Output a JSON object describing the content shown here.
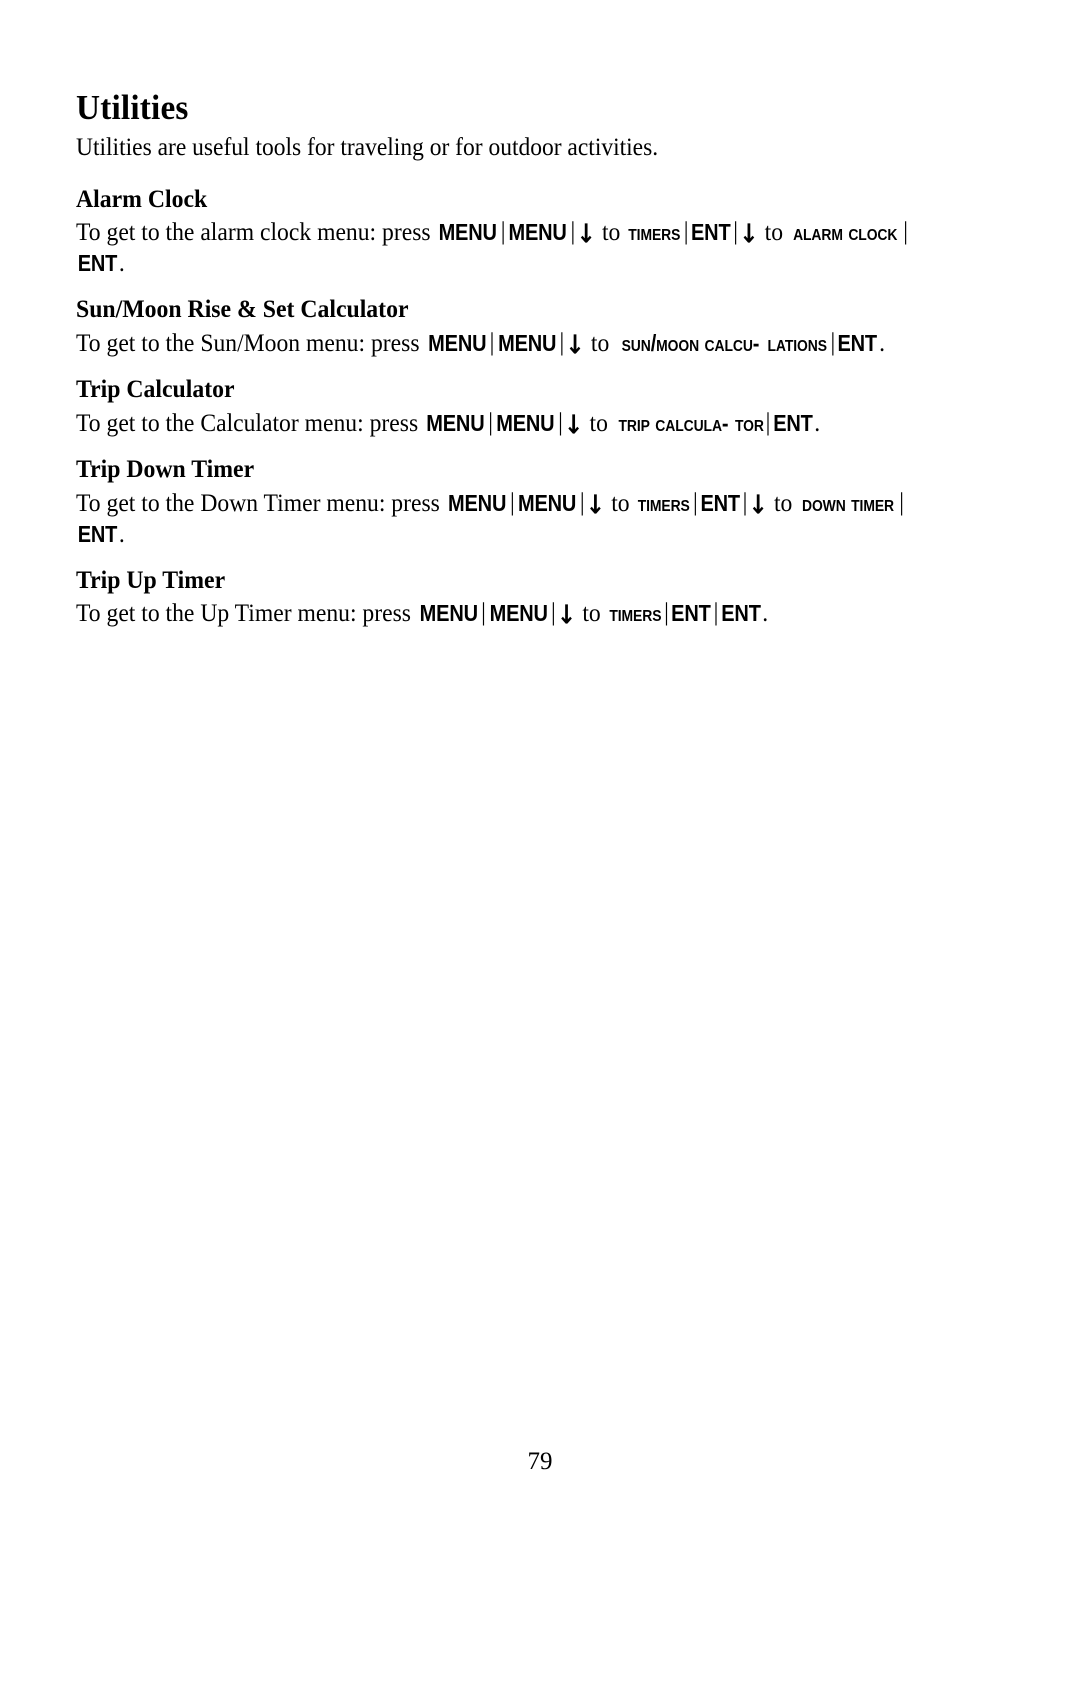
{
  "document": {
    "chapter_title": "Utilities",
    "intro": "Utilities are useful tools for traveling or for outdoor activities.",
    "page_number": "79"
  },
  "tokens": {
    "menu": "MENU",
    "ent": "ENT",
    "arrow_down": "↓",
    "separator": "|",
    "to": "to",
    "press_prefix_alarm": "To get to the alarm clock menu: press ",
    "press_prefix_sunmoon": "To get to the Sun/Moon menu: press ",
    "press_prefix_calc": "To get to the Calculator menu: press ",
    "press_prefix_down": "To get to the Down Timer menu: press ",
    "press_prefix_up": "To get to the Up Timer menu: press ",
    "period": "."
  },
  "sections": [
    {
      "id": "alarm-clock",
      "title": "Alarm Clock",
      "menu_timers": "Timers",
      "menu_alarm_clock": "Alarm Clock"
    },
    {
      "id": "sun-moon",
      "title": "Sun/Moon Rise & Set Calculator",
      "menu_sunmoon_part1": "Sun/Moon Calcu-",
      "menu_sunmoon_part2": "lations"
    },
    {
      "id": "trip-calculator",
      "title": "Trip Calculator",
      "menu_trip_calc_part1": "Trip Calcula-",
      "menu_trip_calc_part2": "tor"
    },
    {
      "id": "trip-down-timer",
      "title": "Trip Down Timer",
      "menu_timers": "Timers",
      "menu_down_timer": "Down Timer"
    },
    {
      "id": "trip-up-timer",
      "title": "Trip Up Timer",
      "menu_timers": "Timers"
    }
  ]
}
